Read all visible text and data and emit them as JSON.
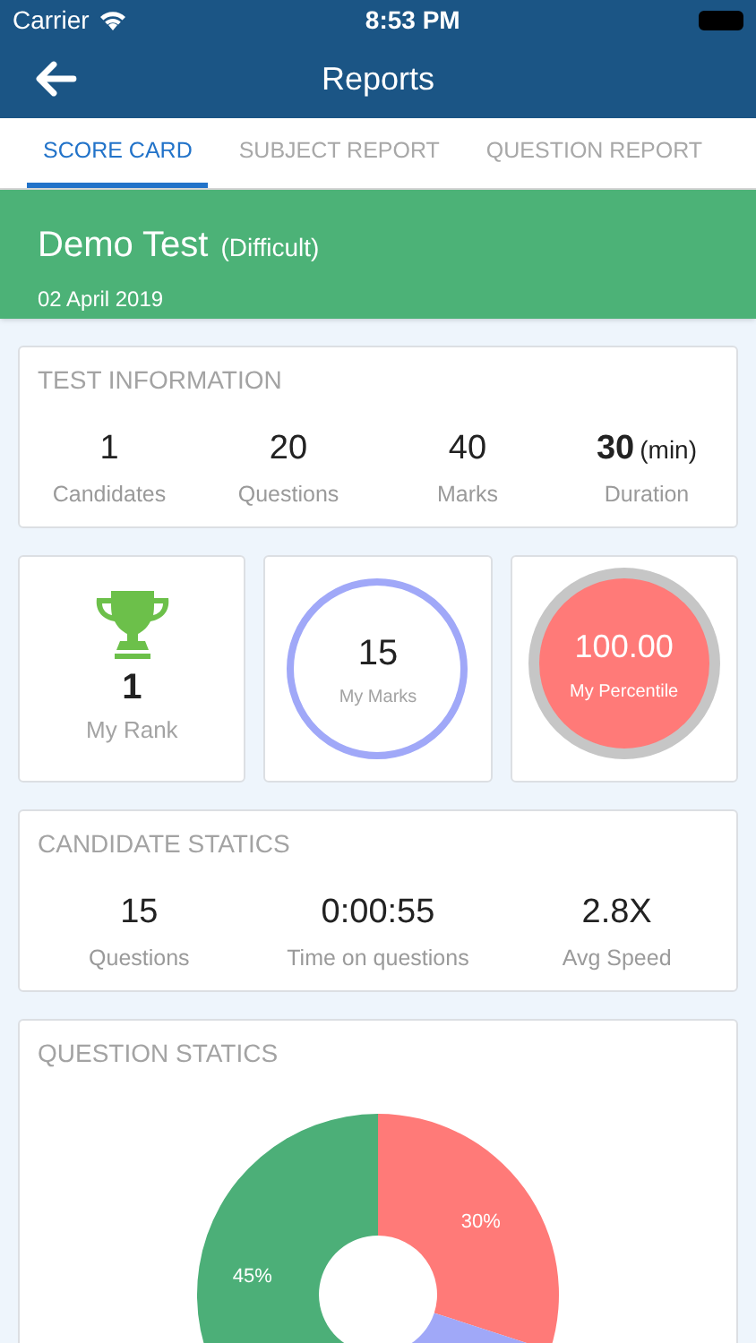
{
  "status_bar": {
    "carrier": "Carrier",
    "time": "8:53 PM"
  },
  "nav": {
    "title": "Reports"
  },
  "tabs": [
    {
      "label": "SCORE CARD",
      "selected": true
    },
    {
      "label": "SUBJECT REPORT",
      "selected": false
    },
    {
      "label": "QUESTION REPORT",
      "selected": false
    }
  ],
  "test": {
    "name": "Demo Test",
    "difficulty": "(Difficult)",
    "date": "02 April 2019"
  },
  "test_information": {
    "title": "TEST INFORMATION",
    "items": [
      {
        "value": "1",
        "label": "Candidates"
      },
      {
        "value": "20",
        "label": "Questions"
      },
      {
        "value": "40",
        "label": "Marks"
      },
      {
        "value": "30",
        "unit": "(min)",
        "label": "Duration"
      }
    ]
  },
  "summary": [
    {
      "kind": "rank",
      "value": "1",
      "label": "My Rank"
    },
    {
      "kind": "ring",
      "value": "15",
      "label": "My Marks"
    },
    {
      "kind": "disc",
      "value": "100.00",
      "label": "My Percentile"
    }
  ],
  "candidate_statics": {
    "title": "CANDIDATE STATICS",
    "items": [
      {
        "value": "15",
        "label": "Questions"
      },
      {
        "value": "0:00:55",
        "label": "Time on questions"
      },
      {
        "value": "2.8X",
        "label": "Avg Speed"
      }
    ]
  },
  "question_statics": {
    "chart_data": {
      "type": "donut",
      "title": "QUESTION STATICS",
      "values": [
        30,
        25,
        45
      ],
      "colors": [
        "#ff7a78",
        "#a0a8f8",
        "#4caf78"
      ],
      "value_labels": [
        "30%",
        null,
        "45%"
      ]
    }
  }
}
